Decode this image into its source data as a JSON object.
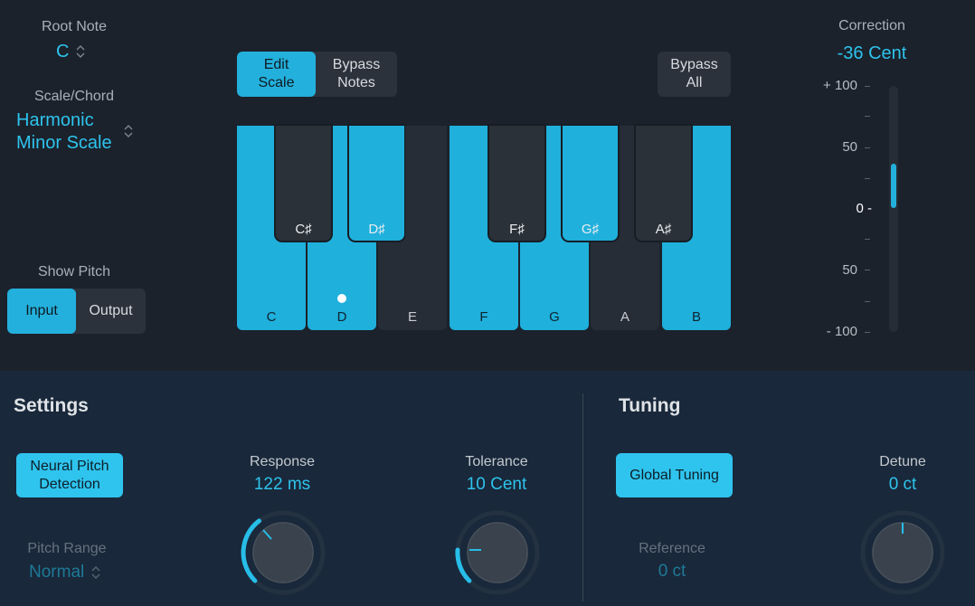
{
  "root_note": {
    "label": "Root Note",
    "value": "C",
    "stepper_icon": "up-down-chevron"
  },
  "scale_chord": {
    "label": "Scale/Chord",
    "value_line1": "Harmonic",
    "value_line2": "Minor Scale"
  },
  "show_pitch": {
    "label": "Show Pitch",
    "options": [
      "Input",
      "Output"
    ],
    "selected": "Input"
  },
  "edit_buttons": {
    "edit_scale_1": "Edit",
    "edit_scale_2": "Scale",
    "bypass_notes_1": "Bypass",
    "bypass_notes_2": "Notes",
    "bypass_all_1": "Bypass",
    "bypass_all_2": "All"
  },
  "keyboard": {
    "white_keys": [
      {
        "name": "C",
        "enabled": true
      },
      {
        "name": "D",
        "enabled": true,
        "pitch_dot": true
      },
      {
        "name": "E",
        "enabled": false
      },
      {
        "name": "F",
        "enabled": true
      },
      {
        "name": "G",
        "enabled": true
      },
      {
        "name": "A",
        "enabled": false
      },
      {
        "name": "B",
        "enabled": true
      }
    ],
    "black_keys": [
      {
        "name": "C♯",
        "enabled": false
      },
      {
        "name": "D♯",
        "enabled": true
      },
      {
        "name": "F♯",
        "enabled": false
      },
      {
        "name": "G♯",
        "enabled": true
      },
      {
        "name": "A♯",
        "enabled": false
      }
    ]
  },
  "correction": {
    "label": "Correction",
    "value": "-36 Cent",
    "scale_labels": [
      "+ 100",
      "50",
      "0 -",
      "50",
      "- 100"
    ],
    "meter_value_cents": -36
  },
  "settings": {
    "title": "Settings",
    "neural_1": "Neural Pitch",
    "neural_2": "Detection",
    "pitch_range_label": "Pitch Range",
    "pitch_range_value": "Normal",
    "response_label": "Response",
    "response_value": "122 ms",
    "tolerance_label": "Tolerance",
    "tolerance_value": "10 Cent"
  },
  "tuning": {
    "title": "Tuning",
    "global_tuning": "Global Tuning",
    "reference_label": "Reference",
    "reference_value": "0 ct",
    "detune_label": "Detune",
    "detune_value": "0 ct"
  },
  "colors": {
    "accent": "#23b0dc",
    "panel": "#1b222c",
    "bottom": "#19283a"
  }
}
